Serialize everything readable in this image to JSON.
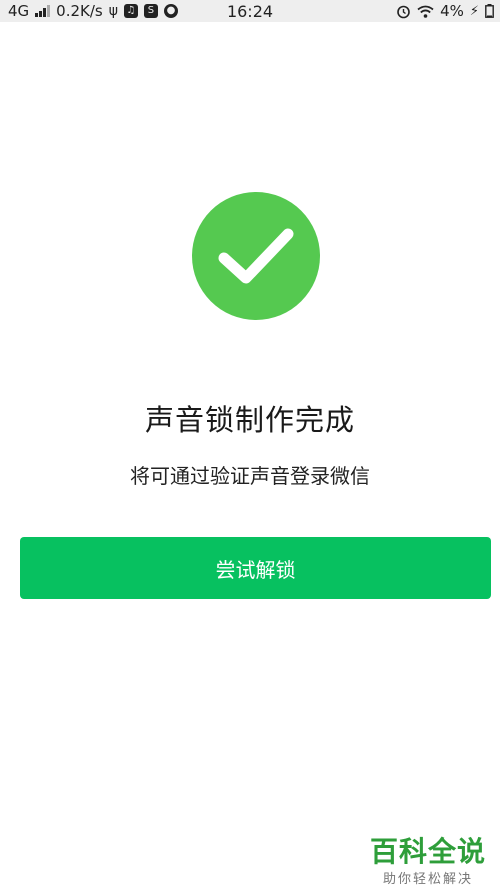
{
  "status_bar": {
    "network": "4G",
    "speed": "0.2K/s",
    "time": "16:24",
    "battery": "4%"
  },
  "colors": {
    "success_green": "#55c950",
    "button_green": "#07c160",
    "watermark_green": "#2e9e3a"
  },
  "main": {
    "icon": "checkmark-circle-icon",
    "title": "声音锁制作完成",
    "subtitle": "将可通过验证声音登录微信",
    "button_label": "尝试解锁"
  },
  "watermark": {
    "brand": "百科全说",
    "tagline": "助你轻松解决"
  }
}
